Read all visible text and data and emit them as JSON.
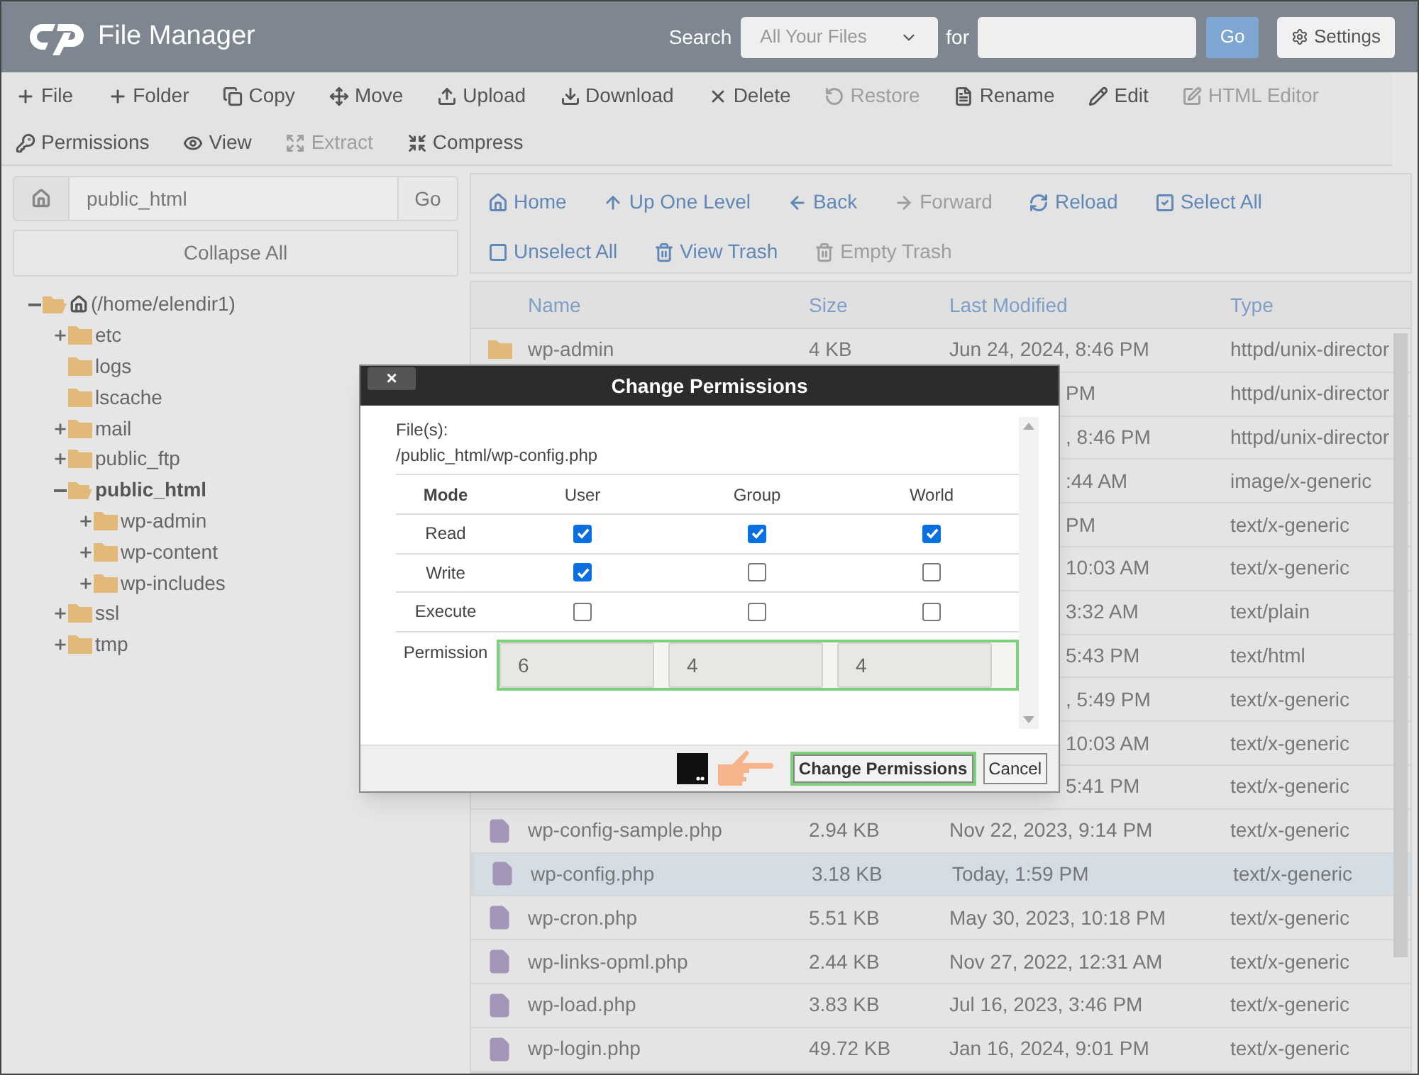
{
  "header": {
    "title": "File Manager",
    "search_label": "Search",
    "search_scope": "All Your Files",
    "for_label": "for",
    "go": "Go",
    "settings": "Settings"
  },
  "toolbar": [
    {
      "label": "File",
      "disabled": false
    },
    {
      "label": "Folder",
      "disabled": false
    },
    {
      "label": "Copy",
      "disabled": false
    },
    {
      "label": "Move",
      "disabled": false
    },
    {
      "label": "Upload",
      "disabled": false
    },
    {
      "label": "Download",
      "disabled": false
    },
    {
      "label": "Delete",
      "disabled": false
    },
    {
      "label": "Restore",
      "disabled": true
    },
    {
      "label": "Rename",
      "disabled": false
    },
    {
      "label": "Edit",
      "disabled": false
    },
    {
      "label": "HTML Editor",
      "disabled": true
    },
    {
      "label": "Permissions",
      "disabled": false
    },
    {
      "label": "View",
      "disabled": false
    },
    {
      "label": "Extract",
      "disabled": true
    },
    {
      "label": "Compress",
      "disabled": false
    }
  ],
  "path": {
    "value": "public_html",
    "go": "Go"
  },
  "collapse_all": "Collapse All",
  "tree": [
    {
      "label": "(/home/elendir1)",
      "expanded": true,
      "selected": false,
      "children": [
        {
          "label": "etc",
          "expanded": false,
          "selected": false
        },
        {
          "label": "logs",
          "selected": false
        },
        {
          "label": "lscache",
          "selected": false
        },
        {
          "label": "mail",
          "expanded": false,
          "selected": false
        },
        {
          "label": "public_ftp",
          "expanded": false,
          "selected": false
        },
        {
          "label": "public_html",
          "expanded": true,
          "selected": true,
          "children": [
            {
              "label": "wp-admin",
              "expanded": false,
              "selected": false
            },
            {
              "label": "wp-content",
              "expanded": false,
              "selected": false
            },
            {
              "label": "wp-includes",
              "expanded": false,
              "selected": false
            }
          ]
        },
        {
          "label": "ssl",
          "expanded": false,
          "selected": false
        },
        {
          "label": "tmp",
          "expanded": false,
          "selected": false
        }
      ]
    }
  ],
  "nav": [
    {
      "label": "Home",
      "disabled": false
    },
    {
      "label": "Up One Level",
      "disabled": false
    },
    {
      "label": "Back",
      "disabled": false
    },
    {
      "label": "Forward",
      "disabled": true
    },
    {
      "label": "Reload",
      "disabled": false
    },
    {
      "label": "Select All",
      "disabled": false
    },
    {
      "label": "Unselect All",
      "disabled": false
    },
    {
      "label": "View Trash",
      "disabled": false
    },
    {
      "label": "Empty Trash",
      "disabled": true
    }
  ],
  "table": {
    "columns": [
      "Name",
      "Size",
      "Last Modified",
      "Type"
    ],
    "rows": [
      {
        "kind": "folder",
        "name": "wp-admin",
        "size": "4 KB",
        "modified": "Jun 24, 2024, 8:46 PM",
        "type": "httpd/unix-director",
        "selected": false
      },
      {
        "kind": "hidden",
        "modified": "PM",
        "type": "httpd/unix-director",
        "selected": false
      },
      {
        "kind": "hidden",
        "modified": ", 8:46 PM",
        "type": "httpd/unix-director",
        "selected": false
      },
      {
        "kind": "hidden",
        "modified": ":44 AM",
        "type": "image/x-generic",
        "selected": false
      },
      {
        "kind": "hidden",
        "modified": "PM",
        "type": "text/x-generic",
        "selected": false
      },
      {
        "kind": "hidden",
        "modified": "10:03 AM",
        "type": "text/x-generic",
        "selected": false
      },
      {
        "kind": "hidden",
        "modified": "3:32 AM",
        "type": "text/plain",
        "selected": false
      },
      {
        "kind": "hidden",
        "modified": "5:43 PM",
        "type": "text/html",
        "selected": false
      },
      {
        "kind": "hidden",
        "modified": ", 5:49 PM",
        "type": "text/x-generic",
        "selected": false
      },
      {
        "kind": "hidden",
        "modified": "10:03 AM",
        "type": "text/x-generic",
        "selected": false
      },
      {
        "kind": "hidden",
        "modified": "5:41 PM",
        "type": "text/x-generic",
        "selected": false
      },
      {
        "kind": "file",
        "name": "wp-config-sample.php",
        "size": "2.94 KB",
        "modified": "Nov 22, 2023, 9:14 PM",
        "type": "text/x-generic",
        "selected": false
      },
      {
        "kind": "file",
        "name": "wp-config.php",
        "size": "3.18 KB",
        "modified": "Today, 1:59 PM",
        "type": "text/x-generic",
        "selected": true
      },
      {
        "kind": "file",
        "name": "wp-cron.php",
        "size": "5.51 KB",
        "modified": "May 30, 2023, 10:18 PM",
        "type": "text/x-generic",
        "selected": false
      },
      {
        "kind": "file",
        "name": "wp-links-opml.php",
        "size": "2.44 KB",
        "modified": "Nov 27, 2022, 12:31 AM",
        "type": "text/x-generic",
        "selected": false
      },
      {
        "kind": "file",
        "name": "wp-load.php",
        "size": "3.83 KB",
        "modified": "Jul 16, 2023, 3:46 PM",
        "type": "text/x-generic",
        "selected": false
      },
      {
        "kind": "file",
        "name": "wp-login.php",
        "size": "49.72 KB",
        "modified": "Jan 16, 2024, 9:01 PM",
        "type": "text/x-generic",
        "selected": false
      }
    ]
  },
  "dialog": {
    "title": "Change Permissions",
    "close": "×",
    "files_label": "File(s):",
    "file_path": "/public_html/wp-config.php",
    "columns": [
      "Mode",
      "User",
      "Group",
      "World"
    ],
    "rows": [
      {
        "label": "Read",
        "user": true,
        "group": true,
        "world": true
      },
      {
        "label": "Write",
        "user": true,
        "group": false,
        "world": false
      },
      {
        "label": "Execute",
        "user": false,
        "group": false,
        "world": false
      }
    ],
    "permission_label": "Permission",
    "permission_values": [
      "6",
      "4",
      "4"
    ],
    "submit": "Change Permissions",
    "cancel": "Cancel"
  }
}
